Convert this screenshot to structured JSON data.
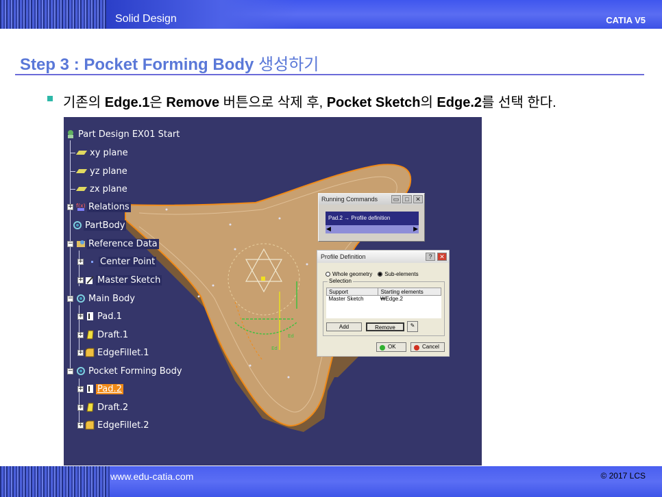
{
  "header": {
    "title": "Solid Design",
    "brand": "CATIA V5"
  },
  "step": {
    "title_en": "Step 3 : Pocket Forming Body",
    "title_kr": "생성하기"
  },
  "bullet": {
    "p1": "기존의 ",
    "b1": "Edge.1",
    "p2": "은 ",
    "b2": "Remove",
    "p3": " 버튼으로 삭제 후, ",
    "b3": "Pocket Sketch",
    "p4": "의 ",
    "b4": "Edge.2",
    "p5": "를 선택 한다."
  },
  "tree": {
    "items": [
      {
        "label": "Part Design EX01 Start",
        "icon": "part-icon"
      },
      {
        "label": "xy plane",
        "icon": "plane-icon"
      },
      {
        "label": "yz plane",
        "icon": "plane-icon"
      },
      {
        "label": "zx plane",
        "icon": "plane-icon"
      },
      {
        "label": "Relations",
        "icon": "relations-icon"
      },
      {
        "label": "PartBody",
        "icon": "body-icon"
      },
      {
        "label": "Reference Data",
        "icon": "set-icon"
      },
      {
        "label": "Center Point",
        "icon": "point-icon"
      },
      {
        "label": "Master Sketch",
        "icon": "sketch-icon"
      },
      {
        "label": "Main Body",
        "icon": "body-icon"
      },
      {
        "label": "Pad.1",
        "icon": "pad-icon"
      },
      {
        "label": "Draft.1",
        "icon": "draft-icon"
      },
      {
        "label": "EdgeFillet.1",
        "icon": "fillet-icon"
      },
      {
        "label": "Pocket Forming Body",
        "icon": "body-icon"
      },
      {
        "label": "Pad.2",
        "icon": "pad-icon"
      },
      {
        "label": "Draft.2",
        "icon": "draft-icon"
      },
      {
        "label": "EdgeFillet.2",
        "icon": "fillet-icon"
      }
    ]
  },
  "running_commands": {
    "title": "Running Commands",
    "command": "Pad.2 → Profile definition"
  },
  "profile_dialog": {
    "title": "Profile Definition",
    "opt_whole": "Whole geometry",
    "opt_sub": "Sub-elements",
    "selection_label": "Selection",
    "col_support": "Support",
    "col_start": "Starting elements",
    "row_support": "Master Sketch",
    "row_start": "₩Edge.2",
    "add": "Add",
    "remove": "Remove",
    "ok": "OK",
    "cancel": "Cancel"
  },
  "footer": {
    "url": "www.edu-catia.com",
    "copyright": "© 2017 LCS"
  },
  "colors": {
    "accent": "#5a78d8",
    "viewport_bg": "#35366a",
    "part_fill": "#c8a070",
    "selection": "#f08a18"
  }
}
